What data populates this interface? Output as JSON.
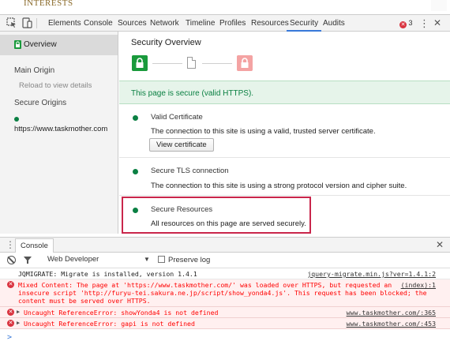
{
  "page": {
    "heading_fragment": "INTERESTS"
  },
  "devtools": {
    "tabs": [
      "Elements",
      "Console",
      "Sources",
      "Network",
      "Timeline",
      "Profiles",
      "Resources",
      "Security",
      "Audits"
    ],
    "active_tab": "Security",
    "error_count": "3"
  },
  "sidebar": {
    "overview": "Overview",
    "main_origin": "Main Origin",
    "reload_hint": "Reload to view details",
    "secure_origins": "Secure Origins",
    "origin": "https://www.taskmother.com"
  },
  "security": {
    "title": "Security Overview",
    "banner": "This page is secure (valid HTTPS).",
    "items": [
      {
        "title": "Valid Certificate",
        "desc": "The connection to this site is using a valid, trusted server certificate.",
        "button": "View certificate"
      },
      {
        "title": "Secure TLS connection",
        "desc": "The connection to this site is using a strong protocol version and cipher suite."
      },
      {
        "title": "Secure Resources",
        "desc": "All resources on this page are served securely."
      }
    ],
    "colors": {
      "secure": "#0b8043",
      "highlight": "#c9264b"
    }
  },
  "drawer": {
    "tab": "Console"
  },
  "console": {
    "context": "Web Developer",
    "preserve_log": "Preserve log",
    "messages": [
      {
        "level": "info",
        "text": "JQMIGRATE: Migrate is installed, version 1.4.1",
        "source": "jquery-migrate.min.js?ver=1.4.1:2"
      },
      {
        "level": "error",
        "lines": [
          "Mixed Content: The page at 'https://www.taskmother.com/' was loaded over HTTPS, but requested an",
          "insecure script 'http://furyu-tei.sakura.ne.jp/script/show_yonda4.js'. This request has been blocked; the",
          "content must be served over HTTPS."
        ],
        "source": "(index):1"
      },
      {
        "level": "error",
        "text": "Uncaught ReferenceError: showYonda4 is not defined",
        "source": "www.taskmother.com/:365"
      },
      {
        "level": "error",
        "text": "Uncaught ReferenceError: gapi is not defined",
        "source": "www.taskmother.com/:453"
      }
    ],
    "prompt": ">"
  }
}
